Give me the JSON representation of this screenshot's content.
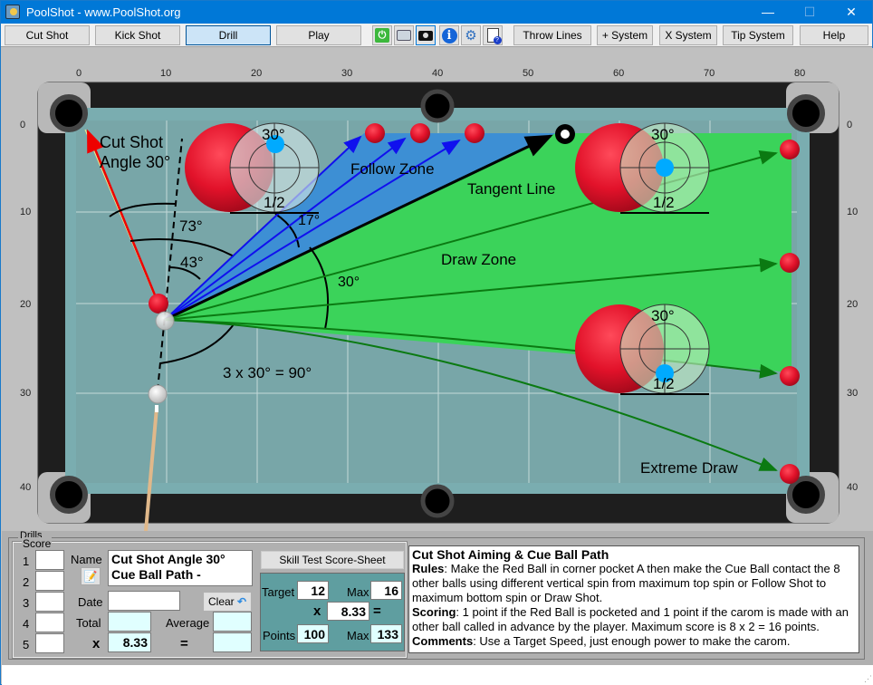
{
  "window": {
    "title": "PoolShot - www.PoolShot.org",
    "minimize": "—",
    "maximize": "☐",
    "close": "✕"
  },
  "toolbar": {
    "mode_buttons": [
      {
        "label": "Cut Shot",
        "active": false
      },
      {
        "label": "Kick Shot",
        "active": false
      },
      {
        "label": "Drill",
        "active": true
      },
      {
        "label": "Play",
        "active": false
      }
    ],
    "icons": [
      "power-icon",
      "print-icon",
      "camera-icon",
      "info-icon",
      "settings-gear-icon",
      "help-document-icon"
    ],
    "right_buttons": [
      "Throw Lines",
      "+ System",
      "X System",
      "Tip System",
      "Help"
    ]
  },
  "table": {
    "x_ticks": [
      "0",
      "10",
      "20",
      "30",
      "40",
      "50",
      "60",
      "70",
      "80"
    ],
    "y_ticks_left": [
      "0",
      "10",
      "20",
      "30",
      "40"
    ],
    "y_ticks_right": [
      "0",
      "10",
      "20",
      "30",
      "40"
    ],
    "annotations": {
      "cut_shot_title_line1": "Cut Shot",
      "cut_shot_title_line2": "Angle 30°",
      "angle_73": "73°",
      "angle_43": "43°",
      "angle_17": "17°",
      "angle_30": "30°",
      "angle_sum": "3 x 30° = 90°",
      "follow_zone": "Follow Zone",
      "tangent_line": "Tangent Line",
      "draw_zone": "Draw Zone",
      "extreme_draw": "Extreme Draw"
    },
    "spin_diagrams": [
      {
        "angle": "30°",
        "fraction": "1/2",
        "spin": "top"
      },
      {
        "angle": "30°",
        "fraction": "1/2",
        "spin": "center"
      },
      {
        "angle": "30°",
        "fraction": "1/2",
        "spin": "bottom"
      }
    ],
    "eight_ball_label": "8",
    "colors": {
      "felt": "#78a6a8",
      "follow_zone": "#3d8fd4",
      "draw_zone": "#3bd35a",
      "red_ball": "#e2122a",
      "cue_tip_dot": "#00aaff"
    }
  },
  "drills": {
    "group_label": "Drills",
    "score_group_label": "Score",
    "score_rows": [
      "1",
      "2",
      "3",
      "4",
      "5"
    ],
    "score_values": [
      "",
      "",
      "",
      "",
      ""
    ],
    "name_label": "Name",
    "name_value_line1": "Cut Shot Angle 30°",
    "name_value_line2": "Cue Ball Path -",
    "date_label": "Date",
    "date_value": "",
    "clear_label": "Clear",
    "total_label": "Total",
    "total_value": "",
    "average_label": "Average",
    "average_value": "",
    "multiply_sign": "x",
    "multiplier_value": "8.33",
    "equals_sign": "=",
    "result_value": ""
  },
  "skill_test": {
    "button_label": "Skill Test Score-Sheet",
    "target_label": "Target",
    "target_value": "12",
    "max_label": "Max",
    "max_value": "16",
    "x_sign": "x",
    "multiplier": "8.33",
    "eq_sign": "=",
    "points_label": "Points",
    "points_value": "100",
    "points_max_label": "Max",
    "points_max_value": "133"
  },
  "description": {
    "title": "Cut Shot Aiming & Cue Ball Path",
    "rules_label": "Rules",
    "rules_text": ": Make the Red Ball in corner pocket A then make the Cue Ball contact the 8 other balls using different vertical spin from maximum top spin or Follow Shot to maximum bottom spin or Draw Shot.",
    "scoring_label": "Scoring",
    "scoring_text": ": 1 point if the Red Ball is pocketed and 1 point if the carom is made with an other ball called in advance by the player. Maximum score is 8 x 2 = 16 points.",
    "comments_label": "Comments",
    "comments_text": ": Use a Target Speed, just enough power to make the carom."
  }
}
